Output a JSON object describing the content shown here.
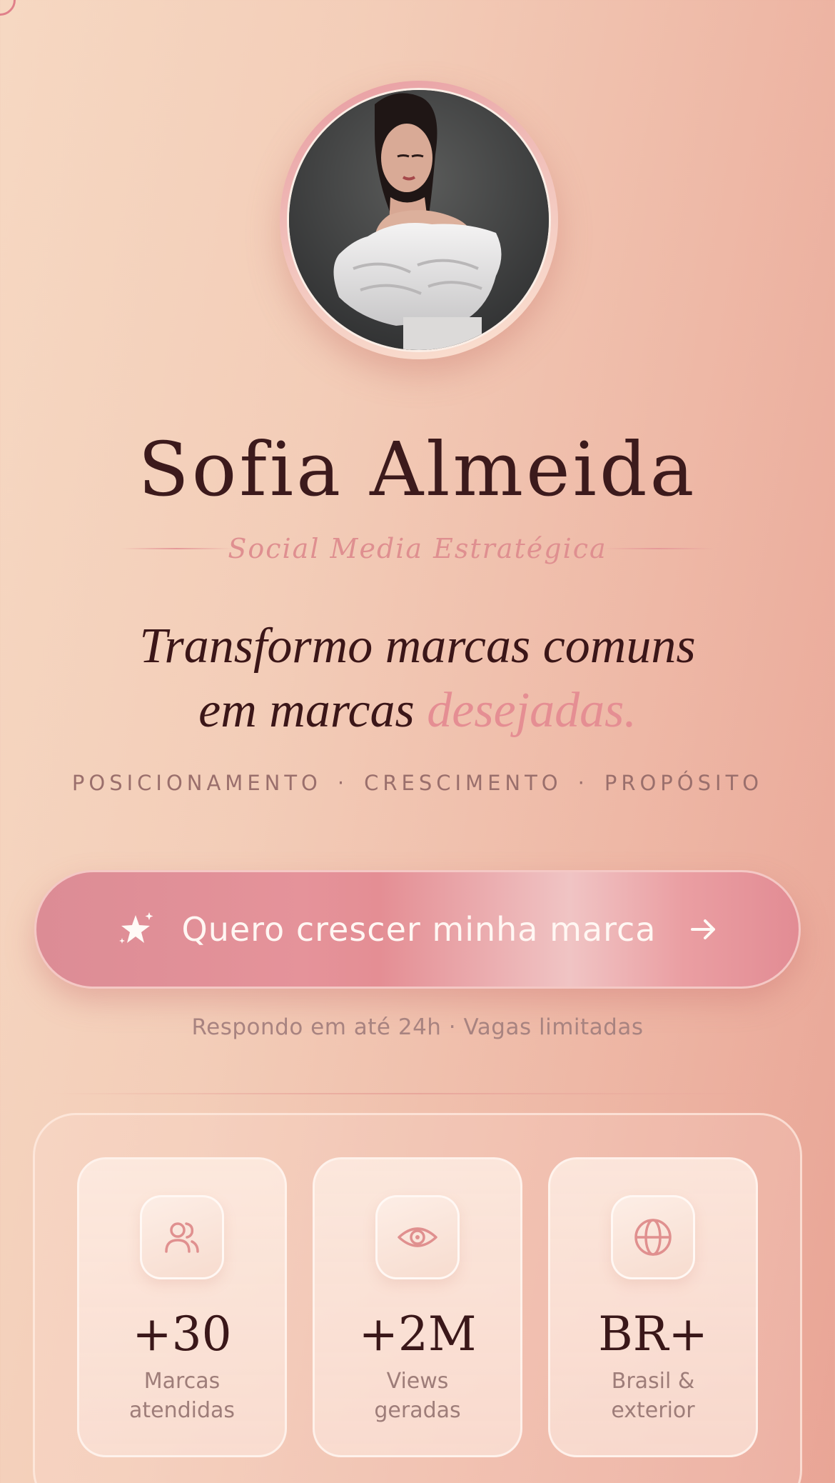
{
  "profile": {
    "name": "Sofia Almeida",
    "role": "Social Media Estratégica"
  },
  "headline": {
    "line1": "Transformo marcas comuns",
    "line2_prefix": "em marcas ",
    "line2_accent": "desejadas."
  },
  "tags": [
    "POSICIONAMENTO",
    "CRESCIMENTO",
    "PROPÓSITO"
  ],
  "tag_separator": "·",
  "cta": {
    "label": "Quero crescer minha marca",
    "icon": "sparkle-star-icon",
    "trailing_icon": "arrow-right-icon"
  },
  "note": "Respondo em até 24h · Vagas limitadas",
  "stats": [
    {
      "icon": "users-icon",
      "value": "+30",
      "label_line1": "Marcas",
      "label_line2": "atendidas"
    },
    {
      "icon": "eye-icon",
      "value": "+2M",
      "label_line1": "Views",
      "label_line2": "geradas"
    },
    {
      "icon": "globe-icon",
      "value": "BR+",
      "label_line1": "Brasil &",
      "label_line2": "exterior"
    }
  ],
  "colors": {
    "accent": "#e58e93",
    "text_dark": "#3b1618",
    "muted": "#9e7d79",
    "cta_start": "#dc8c95",
    "background_start": "#f6d8c2",
    "background_end": "#e9a596"
  }
}
